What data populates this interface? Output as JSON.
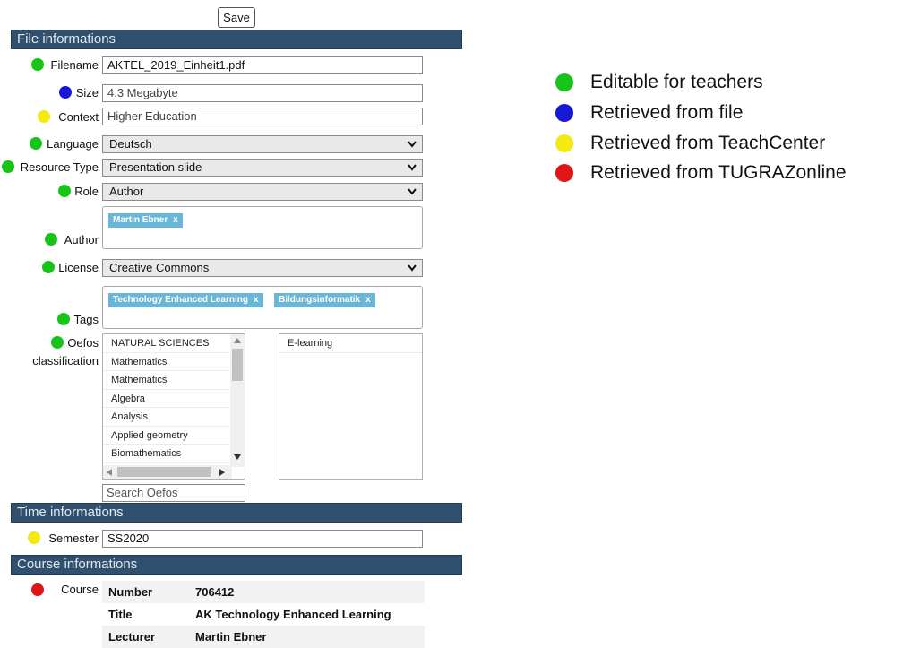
{
  "toolbar": {
    "save_label": "Save"
  },
  "sections": {
    "file": "File informations",
    "time": "Time informations",
    "course": "Course informations"
  },
  "colors": {
    "green": "#17c417",
    "blue": "#1717d6",
    "yellow": "#f2ea12",
    "red": "#e01515",
    "section_bar": "#30506e",
    "chip": "#6ab6d9"
  },
  "fields": {
    "filename": {
      "label": "Filename",
      "value": "AKTEL_2019_Einheit1.pdf",
      "marker": "green"
    },
    "size": {
      "label": "Size",
      "value": "4.3 Megabyte",
      "marker": "blue"
    },
    "context": {
      "label": "Context",
      "value": "Higher Education",
      "marker": "yellow"
    },
    "language": {
      "label": "Language",
      "value": "Deutsch",
      "marker": "green"
    },
    "resource_type": {
      "label": "Resource Type",
      "value": "Presentation slide",
      "marker": "green"
    },
    "role": {
      "label": "Role",
      "value": "Author",
      "marker": "green"
    },
    "author": {
      "label": "Author",
      "chips": [
        "Martin Ebner"
      ],
      "marker": "green"
    },
    "license": {
      "label": "License",
      "value": "Creative Commons",
      "marker": "green"
    },
    "tags": {
      "label": "Tags",
      "chips": [
        "Technology Enhanced Learning",
        "Bildungsinformatik"
      ],
      "marker": "green"
    },
    "oefos": {
      "label_line1": "Oefos",
      "label_line2": "classification",
      "marker": "green",
      "options": [
        "NATURAL SCIENCES",
        "Mathematics",
        "Mathematics",
        "Algebra",
        "Analysis",
        "Applied geometry",
        "Biomathematics"
      ],
      "selected": [
        "E-learning"
      ],
      "search_placeholder": "Search Oefos"
    },
    "semester": {
      "label": "Semester",
      "value": "SS2020",
      "marker": "yellow"
    },
    "course": {
      "label": "Course",
      "marker": "red"
    }
  },
  "course_table": [
    {
      "key": "Number",
      "value": "706412"
    },
    {
      "key": "Title",
      "value": "AK Technology Enhanced Learning"
    },
    {
      "key": "Lecturer",
      "value": "Martin Ebner"
    }
  ],
  "legend": [
    {
      "color": "green",
      "text": "Editable for teachers"
    },
    {
      "color": "blue",
      "text": "Retrieved from file"
    },
    {
      "color": "yellow",
      "text": "Retrieved from TeachCenter"
    },
    {
      "color": "red",
      "text": "Retrieved from TUGRAZonline"
    }
  ],
  "icons": {
    "chip_remove": "x",
    "dropdown": "chevron-down-icon",
    "scroll_up": "triangle-up-icon",
    "scroll_down": "triangle-down-icon",
    "scroll_left": "triangle-left-icon",
    "scroll_right": "triangle-right-icon"
  }
}
